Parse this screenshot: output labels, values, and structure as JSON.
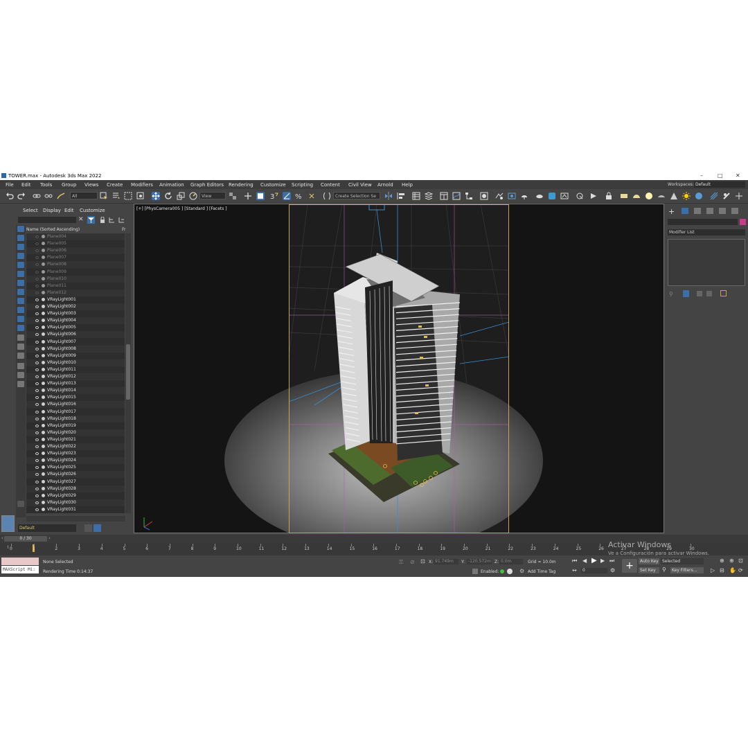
{
  "window": {
    "title": "TOWER.max - Autodesk 3ds Max 2022",
    "minimize": "–",
    "maximize": "□",
    "close": "✕"
  },
  "menu": [
    "File",
    "Edit",
    "Tools",
    "Group",
    "Views",
    "Create",
    "Modifiers",
    "Animation",
    "Graph Editors",
    "Rendering",
    "Customize",
    "Scripting",
    "Content",
    "Civil View",
    "Arnold",
    "Help"
  ],
  "workspace": {
    "label": "Workspaces:",
    "value": "Default"
  },
  "toolbar": {
    "filter_value": "All",
    "view_value": "View",
    "selection_set": "Create Selection Se"
  },
  "scene_explorer": {
    "tabs": [
      "Select",
      "Display",
      "Edit",
      "Customize"
    ],
    "column_header": "Name (Sorted Ascending)",
    "column_header2": "Fr",
    "items": [
      {
        "name": "Plane004",
        "kind": "plane"
      },
      {
        "name": "Plane005",
        "kind": "plane"
      },
      {
        "name": "Plane006",
        "kind": "plane"
      },
      {
        "name": "Plane007",
        "kind": "plane"
      },
      {
        "name": "Plane008",
        "kind": "plane"
      },
      {
        "name": "Plane009",
        "kind": "plane"
      },
      {
        "name": "Plane010",
        "kind": "plane"
      },
      {
        "name": "Plane011",
        "kind": "plane"
      },
      {
        "name": "Plane012",
        "kind": "plane"
      },
      {
        "name": "VRayLight001",
        "kind": "light"
      },
      {
        "name": "VRayLight002",
        "kind": "light"
      },
      {
        "name": "VRayLight003",
        "kind": "light"
      },
      {
        "name": "VRayLight004",
        "kind": "light"
      },
      {
        "name": "VRayLight005",
        "kind": "light"
      },
      {
        "name": "VRayLight006",
        "kind": "light"
      },
      {
        "name": "VRayLight007",
        "kind": "light"
      },
      {
        "name": "VRayLight008",
        "kind": "light"
      },
      {
        "name": "VRayLight009",
        "kind": "light"
      },
      {
        "name": "VRayLight010",
        "kind": "light"
      },
      {
        "name": "VRayLight011",
        "kind": "light"
      },
      {
        "name": "VRayLight012",
        "kind": "light"
      },
      {
        "name": "VRayLight013",
        "kind": "light"
      },
      {
        "name": "VRayLight014",
        "kind": "light"
      },
      {
        "name": "VRayLight015",
        "kind": "light"
      },
      {
        "name": "VRayLight016",
        "kind": "light"
      },
      {
        "name": "VRayLight017",
        "kind": "light"
      },
      {
        "name": "VRayLight018",
        "kind": "light"
      },
      {
        "name": "VRayLight019",
        "kind": "light"
      },
      {
        "name": "VRayLight020",
        "kind": "light"
      },
      {
        "name": "VRayLight021",
        "kind": "light"
      },
      {
        "name": "VRayLight022",
        "kind": "light"
      },
      {
        "name": "VRayLight023",
        "kind": "light"
      },
      {
        "name": "VRayLight024",
        "kind": "light"
      },
      {
        "name": "VRayLight025",
        "kind": "light"
      },
      {
        "name": "VRayLight026",
        "kind": "light"
      },
      {
        "name": "VRayLight027",
        "kind": "light"
      },
      {
        "name": "VRayLight028",
        "kind": "light"
      },
      {
        "name": "VRayLight029",
        "kind": "light"
      },
      {
        "name": "VRayLight030",
        "kind": "light"
      },
      {
        "name": "VRayLight031",
        "kind": "light"
      }
    ],
    "layer": "Default"
  },
  "viewport": {
    "label": "[+] [PhysCamera005 ] [Standard ] [Facets ]"
  },
  "command_panel": {
    "modifier_list": "Modifier List"
  },
  "timeline": {
    "frame_display": "0 / 30",
    "ticks": [
      "0",
      "1",
      "2",
      "3",
      "4",
      "5",
      "6",
      "7",
      "8",
      "9",
      "10",
      "11",
      "12",
      "13",
      "14",
      "15",
      "16",
      "17",
      "18",
      "19",
      "20",
      "21",
      "22",
      "23",
      "24",
      "25",
      "26",
      "27",
      "28",
      "29",
      "30"
    ]
  },
  "status": {
    "maxscript": "MAXScript Mi:",
    "selection": "None Selected",
    "render_time": "Rendering Time  0:14:37",
    "x_label": "X:",
    "x_value": "91.749m",
    "y_label": "Y:",
    "y_value": "-120.572m",
    "z_label": "Z:",
    "z_value": "0.0m",
    "grid": "Grid = 10.0m",
    "enabled": "Enabled:",
    "add_time_tag": "Add Time Tag",
    "auto_key": "Auto Key",
    "selected": "Selected",
    "set_key": "Set Key",
    "key_filters": "Key Filters...",
    "frame": "0"
  },
  "watermark": {
    "line1": "Activar Windows",
    "line2": "Ve a Configuración para activar Windows."
  },
  "colors": {
    "accent": "#3c6fa8",
    "safe_frame": "#c8a64a",
    "layer_text": "#e5c96e"
  }
}
